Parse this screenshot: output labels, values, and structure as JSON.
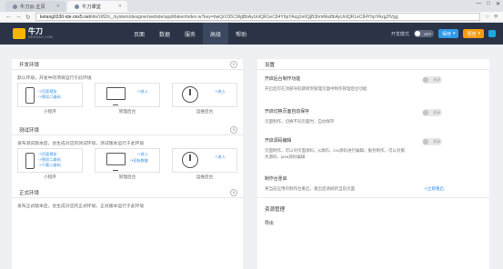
{
  "browser": {
    "tabs": [
      {
        "label": "牛刀云-主页"
      },
      {
        "label": "牛刀课堂"
      }
    ],
    "url_host": "ketang0330-ide.onx5.net",
    "url_path": "/ide/U82/c_/system/designer/webide/appMaker/index.w?key=bwQrO35CMgBbAyUnlQR1eC84YhpYAzg2e0QjB3hmMw8bAyUnlQR1eC84YhpYAzg2fVgg",
    "window_controls": {
      "minimize": "—",
      "maximize": "□",
      "close": "✕"
    }
  },
  "header": {
    "logo_text": "牛刀",
    "logo_sub": "NEWDAO.COM",
    "nav": [
      "页面",
      "数据",
      "服务",
      "高级",
      "帮助"
    ],
    "active_nav": "高级",
    "dev_mode_label": "开发模式",
    "dev_mode_state": "OFF",
    "save_label": "保存",
    "preview_label": "预览"
  },
  "left": {
    "sections": [
      {
        "title": "开发环境",
        "desc": "默认环境，开发中的项目运行于此环境",
        "cards": [
          {
            "caption": "小程序",
            "links": [
              "->页面预览",
              "->预览二维码"
            ],
            "link_r": ""
          },
          {
            "caption": "管理后台",
            "links": [],
            "link_r": "->进入"
          },
          {
            "caption": "运维后台",
            "links": [],
            "link_r": "->进入"
          }
        ]
      },
      {
        "title": "测试环境",
        "desc": "发布测试版本后，会生成对应的测试环境，测试版本运行于此环境",
        "cards": [
          {
            "caption": "小程序",
            "links": [
              "->页面预览",
              "->预览二维码",
              "->下载二维码"
            ],
            "link_r": ""
          },
          {
            "caption": "管理后台",
            "links": [],
            "link_r": "->进入"
          },
          {
            "caption": "运维后台",
            "links": [],
            "link_r": "->进入"
          }
        ],
        "extra_link": "->初始数据"
      },
      {
        "title": "正式环境",
        "desc": "发布正式版本后，会生成对应的正式环境，正式版本运行于此环境"
      }
    ]
  },
  "right": {
    "title": "设置",
    "items": [
      {
        "head": "开启后台制作功能",
        "desc": "开启后可在顶部导航跳转到管理页面中制作管理后台功能",
        "switch": "关闭"
      },
      {
        "head": "开启切换页面自动保存",
        "desc": "页面制作，切换不同页面时，自动保存",
        "switch": "关闭"
      },
      {
        "head": "开启源码编辑",
        "desc": "页面制作，可以对页面源码、js源码、css源码进行编辑；服务制作，可以对服务源码、java源码编辑",
        "switch": "关闭"
      },
      {
        "head": "制作台重启",
        "desc": "将当前应用的制作台重启，重启后请刷新当前页面",
        "link": "->立即重启"
      }
    ],
    "res_title": "资源管理",
    "export_label": "导出"
  }
}
